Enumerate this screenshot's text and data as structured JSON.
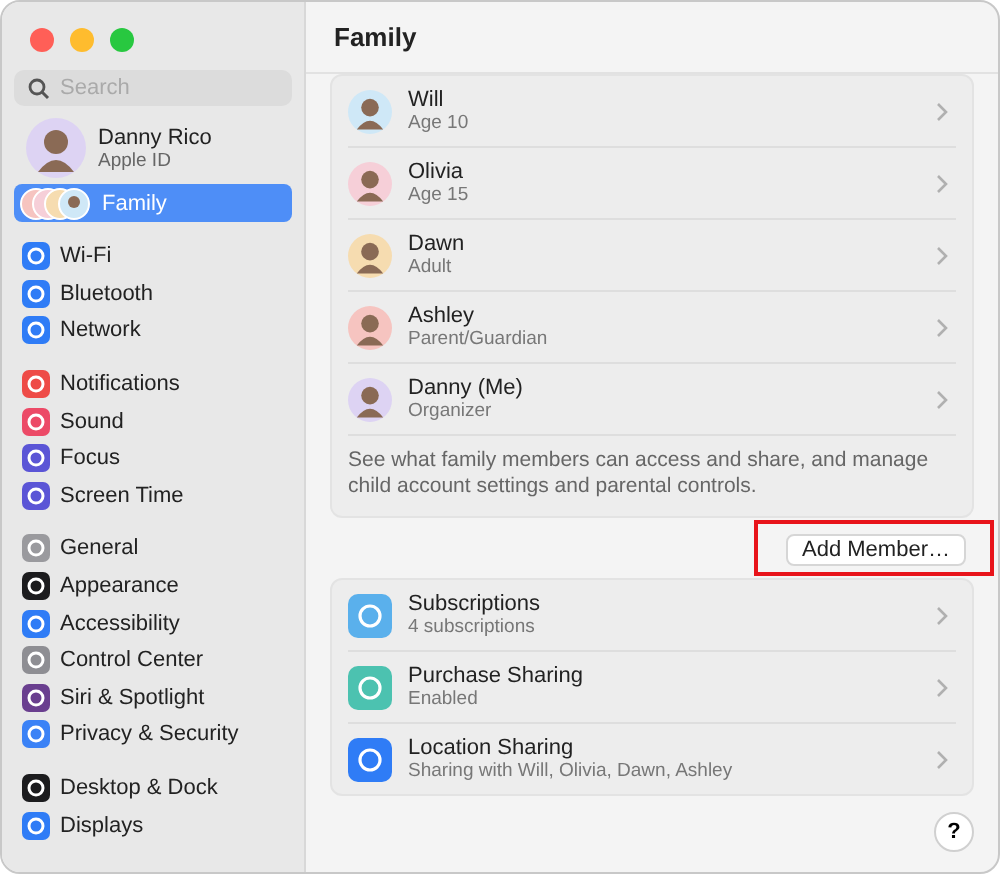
{
  "window": {
    "title": "Family"
  },
  "sidebar": {
    "search": {
      "placeholder": "Search"
    },
    "account": {
      "name": "Danny Rico",
      "subtitle": "Apple ID"
    },
    "family": {
      "label": "Family",
      "selected": true
    },
    "groups": [
      [
        {
          "label": "Wi-Fi",
          "color": "#2f7cf6",
          "selected": false
        },
        {
          "label": "Bluetooth",
          "color": "#2f7cf6",
          "selected": false
        },
        {
          "label": "Network",
          "color": "#2f7cf6",
          "selected": false
        }
      ],
      [
        {
          "label": "Notifications",
          "color": "#ee4b47",
          "selected": false
        },
        {
          "label": "Sound",
          "color": "#ec4a67",
          "selected": false
        },
        {
          "label": "Focus",
          "color": "#5b55d6",
          "selected": false
        },
        {
          "label": "Screen Time",
          "color": "#5b55d6",
          "selected": false
        }
      ],
      [
        {
          "label": "General",
          "color": "#9a9a9e",
          "selected": false
        },
        {
          "label": "Appearance",
          "color": "#1c1c1e",
          "selected": false
        },
        {
          "label": "Accessibility",
          "color": "#2f7cf6",
          "selected": false
        },
        {
          "label": "Control Center",
          "color": "#8e8e93",
          "selected": false
        },
        {
          "label": "Siri & Spotlight",
          "color": "#6a3f8f",
          "selected": false
        },
        {
          "label": "Privacy & Security",
          "color": "#3b82f6",
          "selected": false
        }
      ],
      [
        {
          "label": "Desktop & Dock",
          "color": "#1c1c1e",
          "selected": false
        },
        {
          "label": "Displays",
          "color": "#2f7cf6",
          "selected": false
        }
      ]
    ]
  },
  "members": [
    {
      "name": "Will",
      "role": "Age 10",
      "color": "#cfe8f7"
    },
    {
      "name": "Olivia",
      "role": "Age 15",
      "color": "#f6cfd8"
    },
    {
      "name": "Dawn",
      "role": "Adult",
      "color": "#f6dcb0"
    },
    {
      "name": "Ashley",
      "role": "Parent/Guardian",
      "color": "#f6c4c0"
    },
    {
      "name": "Danny (Me)",
      "role": "Organizer",
      "color": "#ddd3f3"
    }
  ],
  "note": "See what family members can access and share, and manage child account settings and parental controls.",
  "add_member_button": {
    "label": "Add Member…",
    "highlighted": true
  },
  "features": [
    {
      "title": "Subscriptions",
      "subtitle": "4 subscriptions",
      "color": "#5ab0ec"
    },
    {
      "title": "Purchase Sharing",
      "subtitle": "Enabled",
      "color": "#4cc2b0"
    },
    {
      "title": "Location Sharing",
      "subtitle": "Sharing with Will, Olivia, Dawn, Ashley",
      "color": "#2f7cf6"
    }
  ],
  "help_button": {
    "label": "?"
  }
}
